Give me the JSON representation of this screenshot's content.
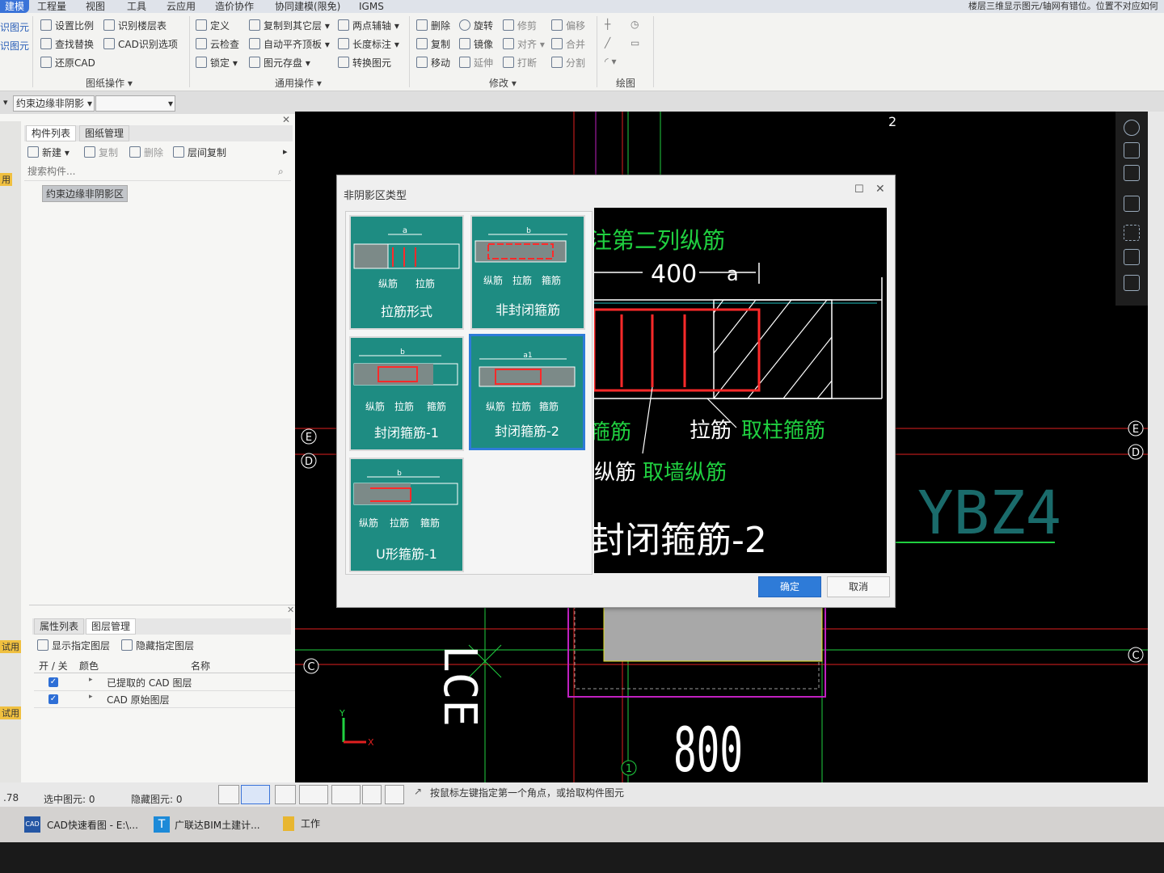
{
  "ribbon": {
    "tabs": [
      "建模",
      "工程量",
      "视图",
      "工具",
      "云应用",
      "造价协作",
      "协同建模(限免)",
      "IGMS"
    ],
    "status_notice": "楼层三维显示图元/轴网有错位。位置不对应如何",
    "left_cut": [
      "识图元",
      "识图元"
    ],
    "drawing_ops": {
      "items": [
        "设置比例",
        "识别楼层表",
        "查找替换",
        "CAD识别选项",
        "还原CAD"
      ],
      "group": "图纸操作"
    },
    "general_ops": {
      "items": [
        "定义",
        "复制到其它层",
        "两点辅轴",
        "云检查",
        "自动平齐顶板",
        "长度标注",
        "锁定",
        "图元存盘",
        "转换图元"
      ],
      "group": "通用操作"
    },
    "modify": {
      "items": [
        "删除",
        "旋转",
        "修剪",
        "偏移",
        "复制",
        "镜像",
        "对齐",
        "合并",
        "移动",
        "延伸",
        "打断",
        "分割"
      ],
      "group": "修改"
    },
    "draw": {
      "group": "绘图"
    }
  },
  "layerbar": {
    "type_value": "约束边缘非阴影",
    "second_value": ""
  },
  "left_top_panel": {
    "tabs": [
      "构件列表",
      "图纸管理"
    ],
    "actions": [
      "新建",
      "复制",
      "删除",
      "层间复制"
    ],
    "search_placeholder": "搜索构件...",
    "items": [
      "约束边缘非阴影区"
    ]
  },
  "left_bottom_panel": {
    "tabs": [
      "属性列表",
      "图层管理"
    ],
    "actions": [
      "显示指定图层",
      "隐藏指定图层"
    ],
    "headers": [
      "开 / 关",
      "颜色",
      "名称"
    ],
    "rows": [
      {
        "name": "已提取的 CAD 图层",
        "checked": true
      },
      {
        "name": "CAD 原始图层",
        "checked": true
      }
    ]
  },
  "left_strip_labels": [
    "用",
    "试用",
    "试用"
  ],
  "dialog": {
    "title": "非阴影区类型",
    "options": [
      {
        "name": "拉筋形式",
        "labels": [
          "纵筋",
          "拉筋"
        ],
        "selected": false
      },
      {
        "name": "非封闭箍筋",
        "labels": [
          "纵筋",
          "拉筋",
          "箍筋"
        ],
        "selected": false
      },
      {
        "name": "封闭箍筋-1",
        "labels": [
          "纵筋",
          "拉筋",
          "箍筋"
        ],
        "selected": false
      },
      {
        "name": "封闭箍筋-2",
        "labels": [
          "纵筋",
          "拉筋",
          "箍筋"
        ],
        "selected": true
      },
      {
        "name": "U形箍筋-1",
        "labels": [
          "纵筋",
          "拉筋",
          "箍筋"
        ],
        "selected": false
      }
    ],
    "dims": [
      "a",
      "b",
      "a1"
    ],
    "preview": {
      "top_text": "注第二列纵筋",
      "dim_400": "400",
      "dim_a": "a",
      "label_stirrup": "箍筋",
      "label_tie": "拉筋",
      "label_tie_rule": "取柱箍筋",
      "label_long": "纵筋",
      "label_long_rule": "取墙纵筋",
      "big_name": "封闭箍筋-2"
    },
    "ok": "确定",
    "cancel": "取消"
  },
  "cad": {
    "axis_num_top": "2",
    "axes": [
      "E",
      "D",
      "C"
    ],
    "axis_bottom": "1",
    "label_ybz": "YBZ4",
    "dim_800": "800",
    "side_text": "LCE"
  },
  "statusbar": {
    "left_value": ".78",
    "selected": "选中图元: 0",
    "hidden": "隐藏图元: 0",
    "hint": "按鼠标左键指定第一个角点，或拾取构件图元"
  },
  "taskbar": {
    "items": [
      "CAD快速看图 - E:\\...",
      "广联达BIM土建计...",
      "工作"
    ]
  },
  "colors": {
    "accent": "#3a73d8",
    "card": "#1e8c82",
    "rebar": "#ff2a2a",
    "cad_green": "#20d040",
    "axis_red": "#e02020"
  }
}
